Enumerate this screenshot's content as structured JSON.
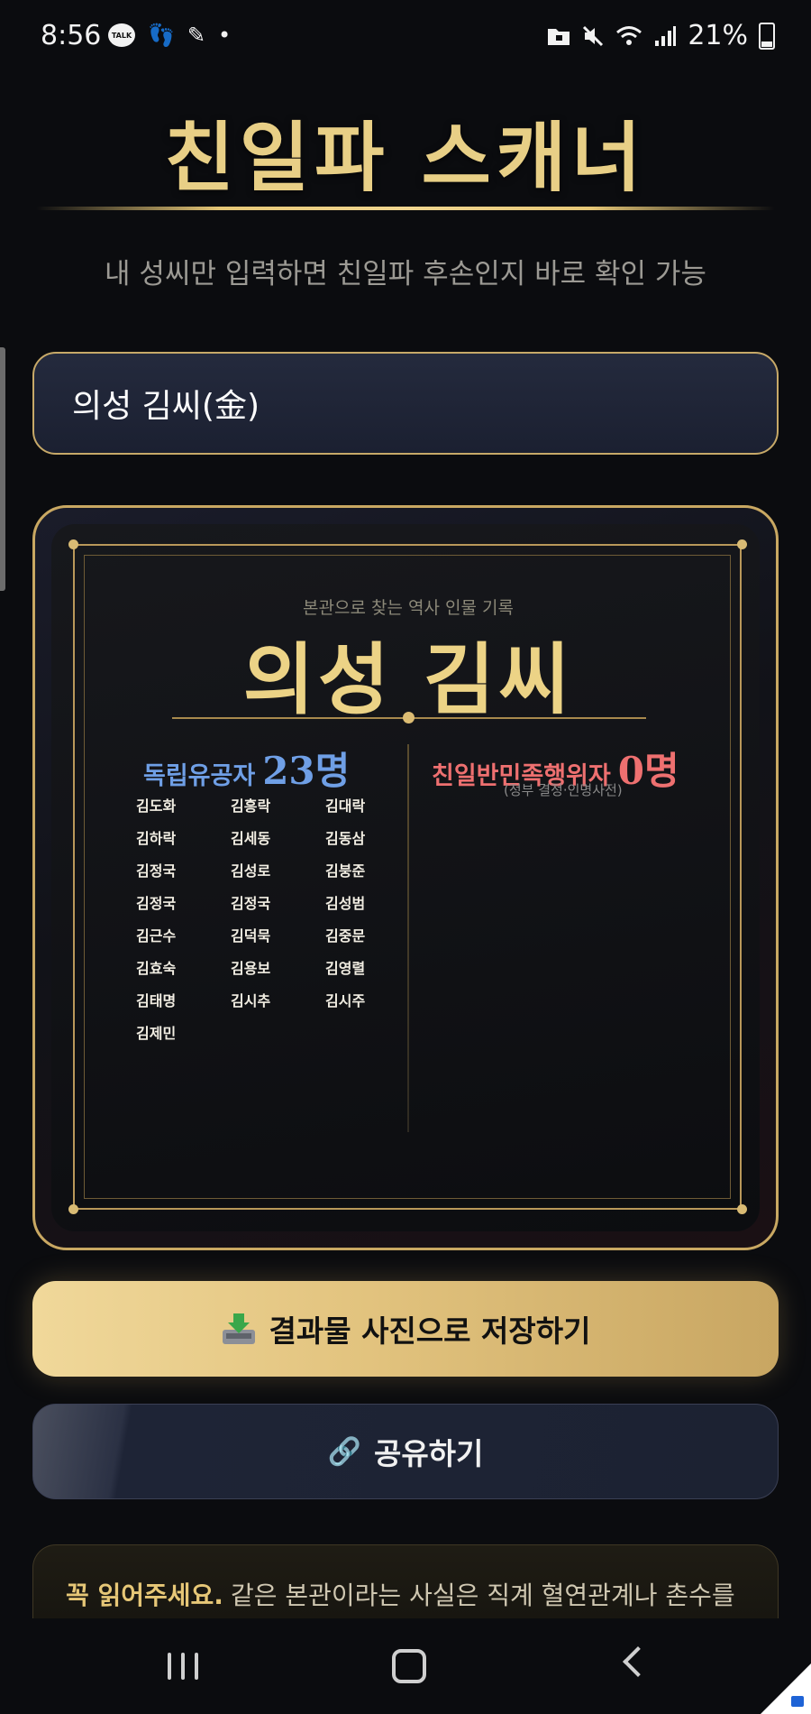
{
  "status_bar": {
    "time": "8:56",
    "talk_badge": "TALK",
    "battery_percent": "21%",
    "left_icons": [
      "kakaotalk-icon",
      "footsteps-icon",
      "pen-icon",
      "dot-icon"
    ],
    "right_icons": [
      "folder-lock-icon",
      "mute-icon",
      "wifi-icon",
      "signal-icon",
      "battery-icon"
    ]
  },
  "header": {
    "title": "친일파 스캐너",
    "subtitle": "내 성씨만 입력하면 친일파 후손인지 바로 확인 가능"
  },
  "search": {
    "value": "의성 김씨(金)"
  },
  "result_card": {
    "kicker": "본관으로 찾는 역사 인물 기록",
    "clan_name": "의성 김씨",
    "independence": {
      "label": "독립유공자",
      "count": "23명",
      "names": [
        "김도화",
        "김흥락",
        "김대락",
        "김하락",
        "김세동",
        "김동삼",
        "김정국",
        "김성로",
        "김붕준",
        "김정국",
        "김정국",
        "김성범",
        "김근수",
        "김덕묵",
        "김중문",
        "김효숙",
        "김용보",
        "김영렬",
        "김태명",
        "김시추",
        "김시주",
        "김제민"
      ]
    },
    "collaborators": {
      "label": "친일반민족행위자",
      "count": "0명",
      "note": "(정부 결정·인명사전)"
    }
  },
  "buttons": {
    "save_label": "결과물 사진으로 저장하기",
    "save_icon": "download-tray-icon",
    "share_label": "공유하기",
    "share_icon": "link-icon"
  },
  "notice": {
    "strong": "꼭 읽어주세요.",
    "text": "같은 본관이라는 사실은 직계 혈연관계나 촌수를"
  },
  "colors": {
    "gold": "#e8cf86",
    "independence_blue": "#6f9fe6",
    "collaborator_red": "#ee7070",
    "background": "#0b0c0f"
  }
}
